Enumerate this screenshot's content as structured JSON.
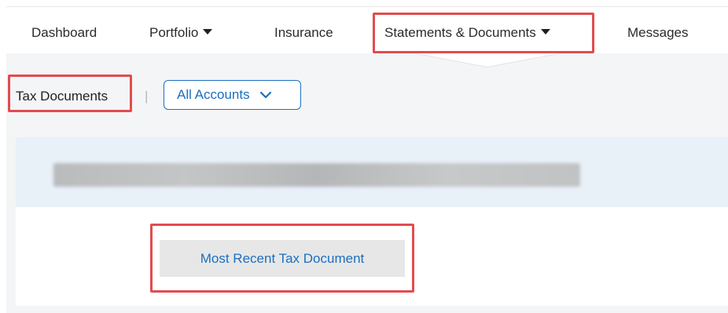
{
  "nav": {
    "dashboard": "Dashboard",
    "portfolio": "Portfolio",
    "insurance": "Insurance",
    "statements": "Statements & Documents",
    "messages": "Messages"
  },
  "subnav": {
    "tax_documents": "Tax Documents",
    "separator": "|",
    "accounts_label": "All Accounts"
  },
  "content": {
    "recent_button": "Most Recent Tax Document"
  },
  "colors": {
    "accent": "#1c6fc1",
    "highlight": "#e34b4f",
    "band": "#e8f0f8"
  }
}
